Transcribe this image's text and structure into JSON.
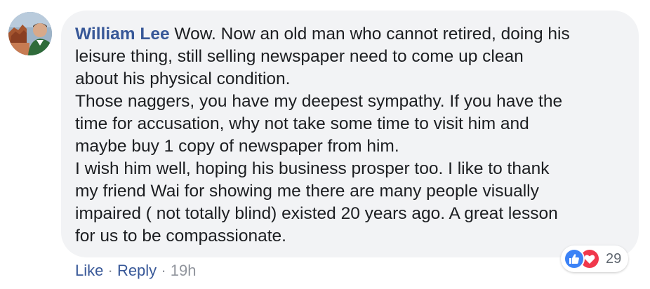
{
  "comment": {
    "author": "William Lee",
    "lines": [
      " Wow. Now an old man who cannot retired, doing his",
      "leisure thing, still selling newspaper need to come up clean",
      "about his physical condition.",
      "Those naggers, you have my deepest sympathy. If you have the",
      "time for accusation, why not take some time to visit him and",
      "maybe buy 1 copy of newspaper from him.",
      "I wish him well, hoping his business prosper too. I like to thank",
      "my friend Wai for showing me there are many people visually",
      "impaired ( not totally blind) existed 20 years ago. A great lesson",
      "for us to be compassionate."
    ]
  },
  "reactions": {
    "types": [
      "like-icon",
      "love-icon"
    ],
    "count": "29",
    "colors": {
      "like": "#3b82f6",
      "love": "#f0384c"
    }
  },
  "actions": {
    "like_label": "Like",
    "separator": "·",
    "reply_label": "Reply",
    "timestamp": "19h"
  },
  "colors": {
    "bubble": "#f2f3f5",
    "author": "#385898",
    "text": "#1c1e21",
    "meta": "#90949c"
  }
}
